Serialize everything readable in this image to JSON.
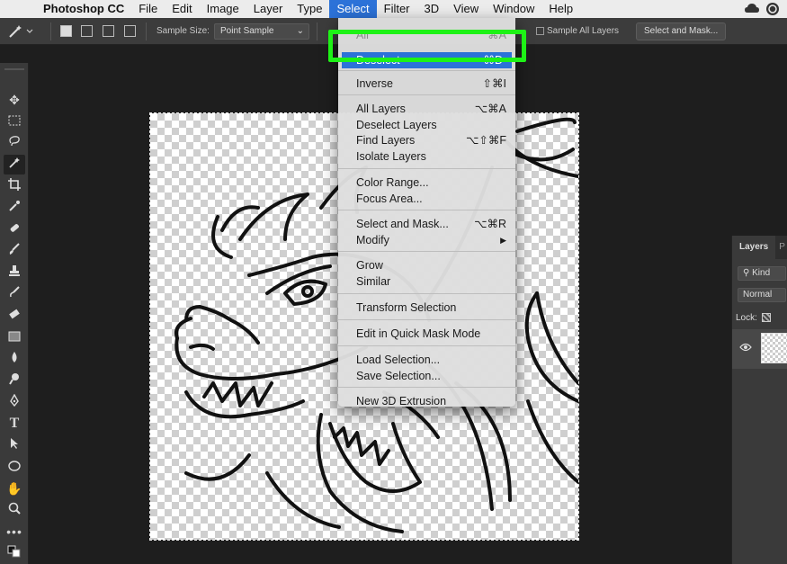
{
  "menubar": {
    "app_name": "Photoshop CC",
    "items": [
      "File",
      "Edit",
      "Image",
      "Layer",
      "Type",
      "Select",
      "Filter",
      "3D",
      "View",
      "Window",
      "Help"
    ],
    "active_item": "Select"
  },
  "options_bar": {
    "sample_size_label": "Sample Size:",
    "sample_size_value": "Point Sample",
    "sample_all_layers_label": "Sample All Layers",
    "select_and_mask_button": "Select and Mask..."
  },
  "select_menu": {
    "items": [
      {
        "label": "All",
        "shortcut": "⌘A",
        "state": "partially-hidden"
      },
      {
        "label": "Deselect",
        "shortcut": "⌘D",
        "state": "highlighted"
      },
      {
        "label": "Inverse",
        "shortcut": "⇧⌘I"
      },
      {
        "label": "All Layers",
        "shortcut": "⌥⌘A"
      },
      {
        "label": "Deselect Layers",
        "shortcut": ""
      },
      {
        "label": "Find Layers",
        "shortcut": "⌥⇧⌘F"
      },
      {
        "label": "Isolate Layers",
        "shortcut": ""
      },
      {
        "label": "Color Range...",
        "shortcut": ""
      },
      {
        "label": "Focus Area...",
        "shortcut": ""
      },
      {
        "label": "Select and Mask...",
        "shortcut": "⌥⌘R"
      },
      {
        "label": "Modify",
        "shortcut": "▶"
      },
      {
        "label": "Grow",
        "shortcut": ""
      },
      {
        "label": "Similar",
        "shortcut": ""
      },
      {
        "label": "Transform Selection",
        "shortcut": ""
      },
      {
        "label": "Edit in Quick Mask Mode",
        "shortcut": ""
      },
      {
        "label": "Load Selection...",
        "shortcut": ""
      },
      {
        "label": "Save Selection...",
        "shortcut": ""
      },
      {
        "label": "New 3D Extrusion",
        "shortcut": ""
      }
    ],
    "highlight_color": "#2c72d8"
  },
  "layers_panel": {
    "tab_label": "Layers",
    "tab2_label": "P",
    "kind_label": "Kind",
    "blend_mode": "Normal",
    "lock_label": "Lock:"
  },
  "annotation": {
    "highlight_color": "#1ef216",
    "target": "Deselect"
  },
  "tools": [
    "move-tool",
    "marquee-tool",
    "lasso-tool",
    "magic-wand-tool",
    "crop-tool",
    "eyedropper-tool",
    "healing-brush-tool",
    "brush-tool",
    "clone-stamp-tool",
    "history-brush-tool",
    "eraser-tool",
    "gradient-tool",
    "blur-tool",
    "dodge-tool",
    "pen-tool",
    "type-tool",
    "path-selection-tool",
    "ellipse-tool",
    "hand-tool",
    "zoom-tool",
    "more-tools"
  ]
}
